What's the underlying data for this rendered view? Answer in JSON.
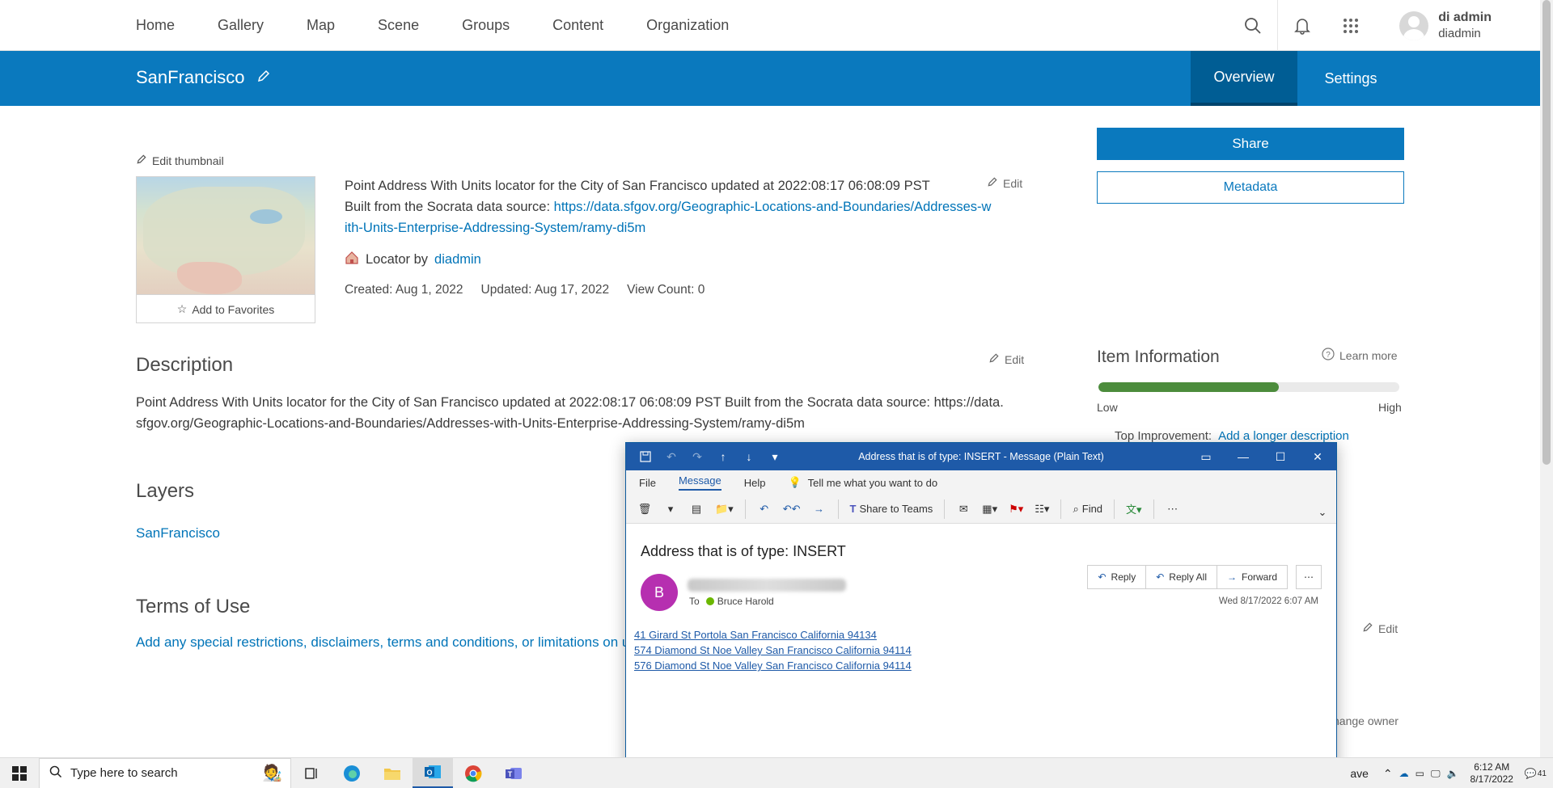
{
  "topnav": {
    "items": [
      "Home",
      "Gallery",
      "Map",
      "Scene",
      "Groups",
      "Content",
      "Organization"
    ],
    "user_name": "di admin",
    "user_id": "diadmin"
  },
  "header": {
    "title": "SanFrancisco",
    "tabs": [
      "Overview",
      "Settings"
    ]
  },
  "item": {
    "edit_thumbnail": "Edit thumbnail",
    "add_favorites": "Add to Favorites",
    "summary_text": "Point Address With Units locator for the City of San Francisco updated at 2022:08:17 06:08:09 PST",
    "summary_source_prefix": "Built from the Socrata data source:",
    "summary_link": "https://data.sfgov.org/Geographic-Locations-and-Boundaries/Addresses-with-Units-Enterprise-Addressing-System/ramy-di5m",
    "edit": "Edit",
    "locator_by": "Locator by",
    "owner": "diadmin",
    "created": "Created: Aug 1, 2022",
    "updated": "Updated: Aug 17, 2022",
    "view_count": "View Count: 0"
  },
  "description": {
    "title": "Description",
    "text": "Point Address With Units locator for the City of San Francisco updated at 2022:08:17 06:08:09 PST Built from the Socrata data source: https://data.sfgov.org/Geographic-Locations-and-Boundaries/Addresses-with-Units-Enterprise-Addressing-System/ramy-di5m"
  },
  "layers": {
    "title": "Layers",
    "items": [
      "SanFrancisco"
    ]
  },
  "terms": {
    "title": "Terms of Use",
    "placeholder": "Add any special restrictions, disclaimers, terms and conditions, or limitations on using the item's data."
  },
  "sidebar": {
    "share": "Share",
    "metadata": "Metadata",
    "item_info_title": "Item Information",
    "learn_more": "Learn more",
    "quality_fraction": 0.6,
    "low": "Low",
    "high": "High",
    "top_improvement_label": "Top Improvement:",
    "top_improvement_link": "Add a longer description",
    "change_owner": "hange owner"
  },
  "outlook": {
    "window_title": "Address that is of type: INSERT  -  Message (Plain Text)",
    "menu": [
      "File",
      "Message",
      "Help"
    ],
    "tell_me": "Tell me what you want to do",
    "share_to_teams": "Share to Teams",
    "find": "Find",
    "subject": "Address that is of type: INSERT",
    "avatar_letter": "B",
    "to_label": "To",
    "to_name": "Bruce Harold",
    "reply": "Reply",
    "reply_all": "Reply All",
    "forward": "Forward",
    "date": "Wed 8/17/2022 6:07 AM",
    "addresses": [
      "41 Girard St  Portola San Francisco California 94134",
      "574 Diamond St  Noe Valley San Francisco California 94114",
      "576 Diamond St  Noe Valley San Francisco California 94114"
    ],
    "colors": {
      "titlebar": "#1e5aa8",
      "avatar": "#b62fb0"
    }
  },
  "taskbar": {
    "search_placeholder": "Type here to search",
    "tray_text": "ave",
    "time": "6:12 AM",
    "date": "8/17/2022",
    "notif_count": "41"
  },
  "colors": {
    "brand": "#0a79be",
    "link": "#0074b8",
    "quality": "#4c8c3c"
  }
}
